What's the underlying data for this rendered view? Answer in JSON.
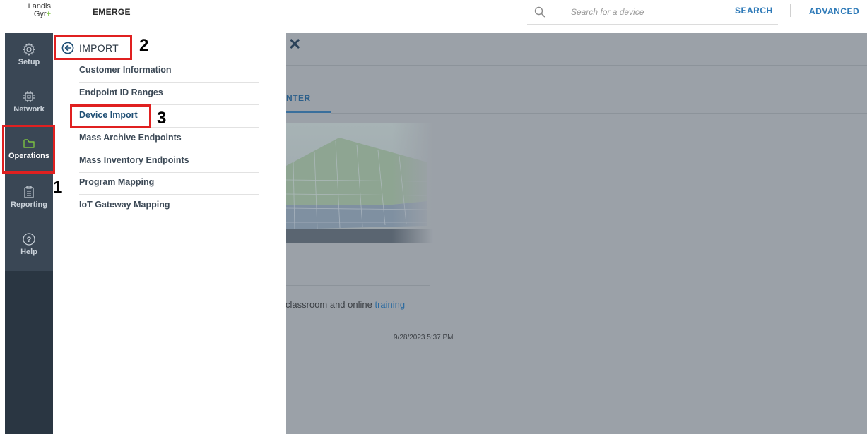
{
  "header": {
    "logo_line1": "Landis",
    "logo_line2": "Gyr",
    "logo_plus": "+",
    "app_name": "EMERGE",
    "search": {
      "placeholder": "Search for a device",
      "value": "",
      "icon": "search-icon"
    },
    "search_button": "SEARCH",
    "advanced_button": "ADVANCED"
  },
  "rail": {
    "items": [
      {
        "label": "Setup",
        "icon": "gear-icon"
      },
      {
        "label": "Network",
        "icon": "chip-icon"
      },
      {
        "label": "Operations",
        "icon": "folder-icon",
        "active": true
      },
      {
        "label": "Reporting",
        "icon": "clipboard-icon"
      },
      {
        "label": "Help",
        "icon": "question-icon"
      }
    ]
  },
  "panel": {
    "title": "IMPORT",
    "back_icon": "back-arrow-icon",
    "items": [
      {
        "label": "Customer Information"
      },
      {
        "label": "Endpoint ID Ranges"
      },
      {
        "label": "Device Import",
        "selected": true
      },
      {
        "label": "Mass Archive Endpoints"
      },
      {
        "label": "Mass Inventory Endpoints"
      },
      {
        "label": "Program Mapping"
      },
      {
        "label": "IoT Gateway Mapping"
      }
    ]
  },
  "background": {
    "close_icon": "close-icon",
    "tab_label": "NTER",
    "training_text": "classroom and online ",
    "training_link": "training",
    "timestamp": "9/28/2023 5:37 PM"
  },
  "annotations": [
    "1",
    "2",
    "3"
  ],
  "colors": {
    "rail_bg": "#2a3642",
    "rail_top_bg": "#3a4755",
    "accent_blue": "#2e7ab8",
    "annotation_red": "#e02020",
    "overlay_gray": "#9ba1a8"
  }
}
